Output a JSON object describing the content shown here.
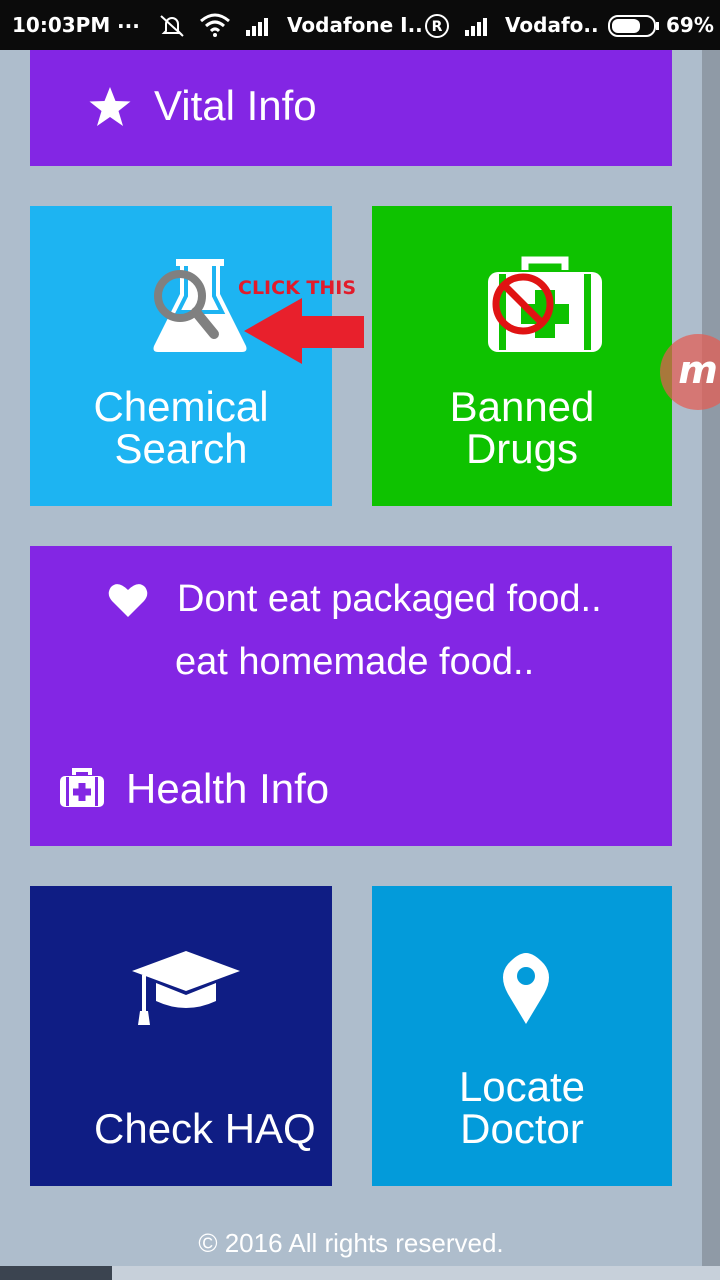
{
  "status_bar": {
    "time": "10:03PM",
    "dots": "...",
    "carrier1": "Vodafone I..",
    "roaming": "R",
    "carrier2": "Vodafo..",
    "battery": "69%",
    "battery_level": 0.69
  },
  "vital_info": {
    "label": "Vital Info",
    "icon": "star-icon"
  },
  "chemical_search": {
    "label_line1": "Chemical",
    "label_line2": "Search",
    "icon": "flask-search-icon"
  },
  "annotation": {
    "text": "CLICK THIS",
    "color": "#e21b2a"
  },
  "banned_drugs": {
    "label_line1": "Banned",
    "label_line2": "Drugs",
    "icon": "banned-medkit-icon"
  },
  "health_card": {
    "message_line1": "Dont eat packaged food..",
    "message_line2": "eat homemade food..",
    "label": "Health Info",
    "heart_icon": "heart-icon",
    "medkit_icon": "medkit-icon"
  },
  "check_haq": {
    "label": "Check HAQ",
    "icon": "graduation-cap-icon"
  },
  "locate_doctor": {
    "label_line1": "Locate",
    "label_line2": "Doctor",
    "icon": "map-pin-icon"
  },
  "footer": {
    "text": "© 2016 All rights reserved."
  },
  "floating_button": {
    "letter": "m"
  },
  "colors": {
    "purple": "#8326e4",
    "sky_blue": "#1db4f2",
    "green": "#0ec200",
    "navy": "#0f1d84",
    "blue": "#039bda",
    "background": "#aebdcc"
  }
}
